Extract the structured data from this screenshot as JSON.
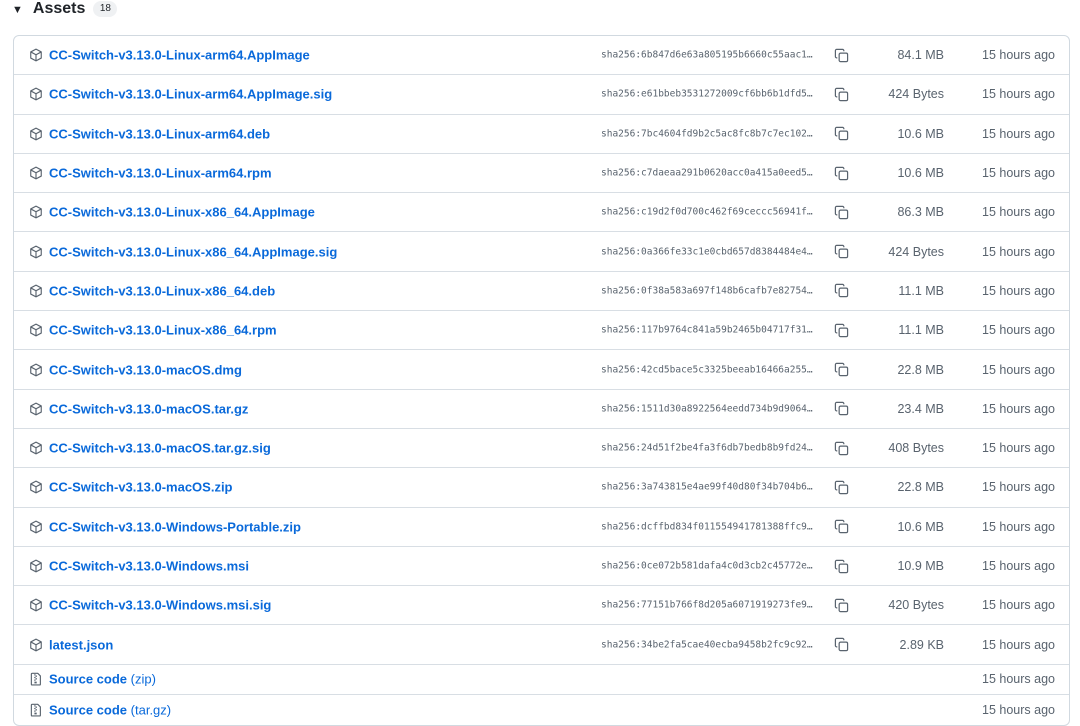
{
  "header": {
    "caret": "▼",
    "title": "Assets",
    "count": "18"
  },
  "assets": [
    {
      "name": "CC-Switch-v3.13.0-Linux-arm64.AppImage",
      "hash": "sha256:6b847d6e63a805195b6660c55aac1…",
      "size": "84.1 MB",
      "time": "15 hours ago"
    },
    {
      "name": "CC-Switch-v3.13.0-Linux-arm64.AppImage.sig",
      "hash": "sha256:e61bbeb3531272009cf6bb6b1dfd5…",
      "size": "424 Bytes",
      "time": "15 hours ago"
    },
    {
      "name": "CC-Switch-v3.13.0-Linux-arm64.deb",
      "hash": "sha256:7bc4604fd9b2c5ac8fc8b7c7ec102…",
      "size": "10.6 MB",
      "time": "15 hours ago"
    },
    {
      "name": "CC-Switch-v3.13.0-Linux-arm64.rpm",
      "hash": "sha256:c7daeaa291b0620acc0a415a0eed5…",
      "size": "10.6 MB",
      "time": "15 hours ago"
    },
    {
      "name": "CC-Switch-v3.13.0-Linux-x86_64.AppImage",
      "hash": "sha256:c19d2f0d700c462f69ceccc56941f…",
      "size": "86.3 MB",
      "time": "15 hours ago"
    },
    {
      "name": "CC-Switch-v3.13.0-Linux-x86_64.AppImage.sig",
      "hash": "sha256:0a366fe33c1e0cbd657d8384484e4…",
      "size": "424 Bytes",
      "time": "15 hours ago"
    },
    {
      "name": "CC-Switch-v3.13.0-Linux-x86_64.deb",
      "hash": "sha256:0f38a583a697f148b6cafb7e82754…",
      "size": "11.1 MB",
      "time": "15 hours ago"
    },
    {
      "name": "CC-Switch-v3.13.0-Linux-x86_64.rpm",
      "hash": "sha256:117b9764c841a59b2465b04717f31…",
      "size": "11.1 MB",
      "time": "15 hours ago"
    },
    {
      "name": "CC-Switch-v3.13.0-macOS.dmg",
      "hash": "sha256:42cd5bace5c3325beeab16466a255…",
      "size": "22.8 MB",
      "time": "15 hours ago"
    },
    {
      "name": "CC-Switch-v3.13.0-macOS.tar.gz",
      "hash": "sha256:1511d30a8922564eedd734b9d9064…",
      "size": "23.4 MB",
      "time": "15 hours ago"
    },
    {
      "name": "CC-Switch-v3.13.0-macOS.tar.gz.sig",
      "hash": "sha256:24d51f2be4fa3f6db7bedb8b9fd24…",
      "size": "408 Bytes",
      "time": "15 hours ago"
    },
    {
      "name": "CC-Switch-v3.13.0-macOS.zip",
      "hash": "sha256:3a743815e4ae99f40d80f34b704b6…",
      "size": "22.8 MB",
      "time": "15 hours ago"
    },
    {
      "name": "CC-Switch-v3.13.0-Windows-Portable.zip",
      "hash": "sha256:dcffbd834f011554941781388ffc9…",
      "size": "10.6 MB",
      "time": "15 hours ago"
    },
    {
      "name": "CC-Switch-v3.13.0-Windows.msi",
      "hash": "sha256:0ce072b581dafa4c0d3cb2c45772e…",
      "size": "10.9 MB",
      "time": "15 hours ago"
    },
    {
      "name": "CC-Switch-v3.13.0-Windows.msi.sig",
      "hash": "sha256:77151b766f8d205a6071919273fe9…",
      "size": "420 Bytes",
      "time": "15 hours ago"
    },
    {
      "name": "latest.json",
      "hash": "sha256:34be2fa5cae40ecba9458b2fc9c92…",
      "size": "2.89 KB",
      "time": "15 hours ago"
    }
  ],
  "source": [
    {
      "name": "Source code",
      "suffix": "(zip)",
      "time": "15 hours ago"
    },
    {
      "name": "Source code",
      "suffix": "(tar.gz)",
      "time": "15 hours ago"
    }
  ],
  "colors": {
    "link": "#0969da",
    "muted": "#59636e",
    "border": "#d1d9e0"
  },
  "icons": {
    "asset": "package-icon",
    "copy": "copy-icon",
    "source": "file-zip-icon"
  }
}
